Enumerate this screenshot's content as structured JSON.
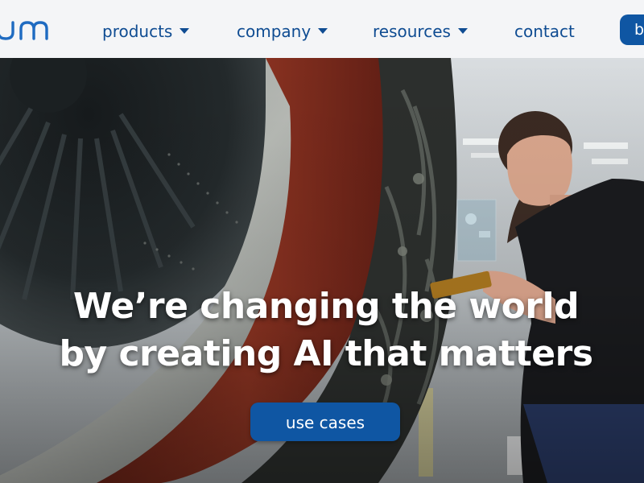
{
  "nav": {
    "brand_icon": "brand-logo-icon",
    "items": [
      {
        "label": "products",
        "has_dropdown": true,
        "icon": "caret-down-icon"
      },
      {
        "label": "company",
        "has_dropdown": true,
        "icon": "caret-down-icon"
      },
      {
        "label": "resources",
        "has_dropdown": true,
        "icon": "caret-down-icon"
      },
      {
        "label": "contact",
        "has_dropdown": false
      }
    ],
    "cta_label": "b"
  },
  "hero": {
    "title_line1": "We’re changing the world",
    "title_line2": "by creating AI that matters",
    "cta_label": "use cases"
  },
  "colors": {
    "brand_blue": "#0f56a3",
    "nav_text": "#0f4c92",
    "nav_background": "#f4f5f7",
    "hero_text": "#ffffff"
  }
}
